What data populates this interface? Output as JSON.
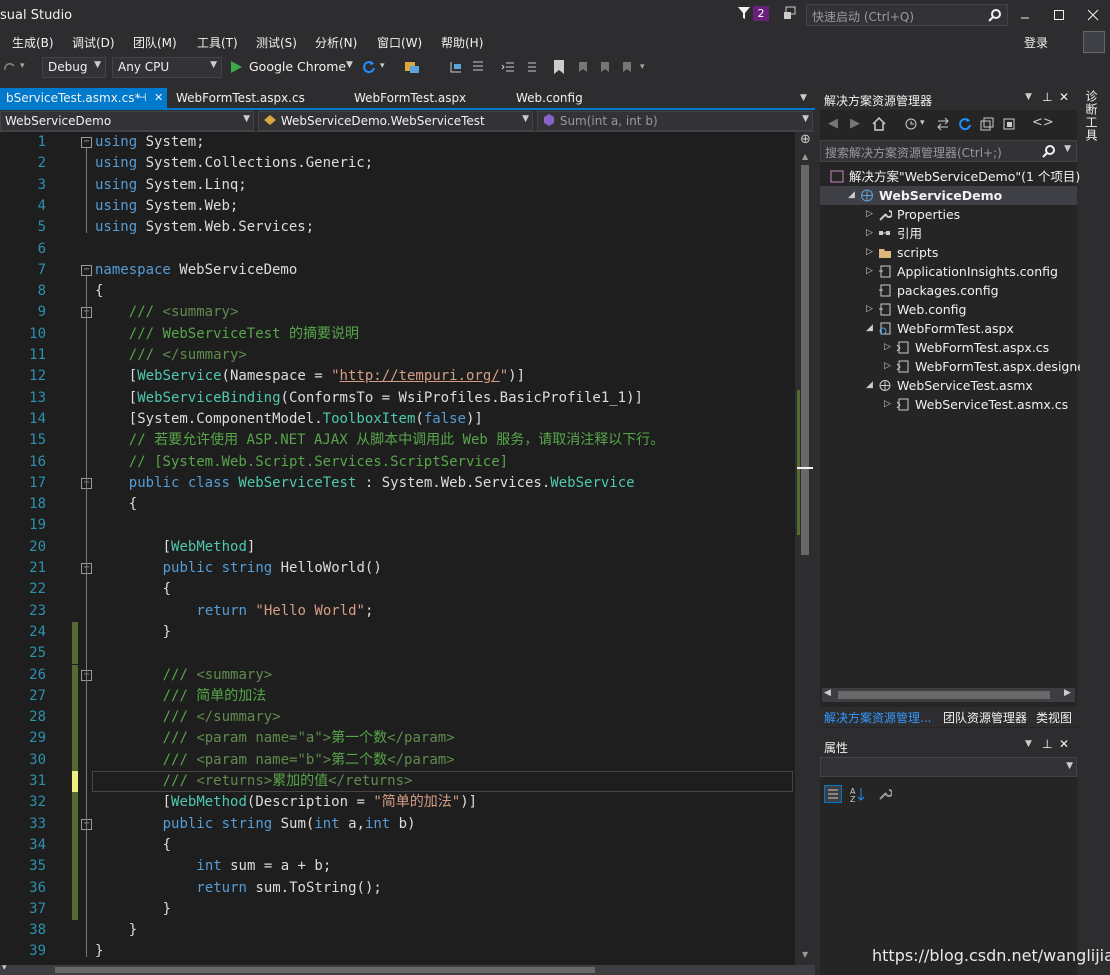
{
  "window": {
    "title": "sual Studio",
    "notification_count": "2",
    "quick_launch_placeholder": "快速启动 (Ctrl+Q)",
    "login": "登录"
  },
  "menu": [
    "生成(B)",
    "调试(D)",
    "团队(M)",
    "工具(T)",
    "测试(S)",
    "分析(N)",
    "窗口(W)",
    "帮助(H)"
  ],
  "toolbar": {
    "config": "Debug",
    "platform": "Any CPU",
    "run_target": "Google Chrome"
  },
  "tabs": [
    {
      "label": "bServiceTest.asmx.cs*",
      "pin": "⊣",
      "close": "✕",
      "active": true
    },
    {
      "label": "WebFormTest.aspx.cs",
      "active": false
    },
    {
      "label": "WebFormTest.aspx",
      "active": false
    },
    {
      "label": "Web.config",
      "active": false
    }
  ],
  "navbar": {
    "project": "WebServiceDemo",
    "type": "WebServiceDemo.WebServiceTest",
    "member": "Sum(int a, int b)"
  },
  "line_numbers": [
    "1",
    "2",
    "3",
    "4",
    "5",
    "6",
    "7",
    "8",
    "9",
    "10",
    "11",
    "12",
    "13",
    "14",
    "15",
    "16",
    "17",
    "18",
    "19",
    "20",
    "21",
    "22",
    "23",
    "24",
    "25",
    "26",
    "27",
    "28",
    "29",
    "30",
    "31",
    "32",
    "33",
    "34",
    "35",
    "36",
    "37",
    "38",
    "39"
  ],
  "code": {
    "l1": [
      "using",
      " System;"
    ],
    "l2": [
      "using",
      " System.Collections.Generic;"
    ],
    "l3": [
      "using",
      " System.Linq;"
    ],
    "l4": [
      "using",
      " System.Web;"
    ],
    "l5": [
      "using",
      " System.Web.Services;"
    ],
    "l7": [
      "namespace",
      " WebServiceDemo"
    ],
    "l8": "{",
    "l9": [
      "/// ",
      "<summary>"
    ],
    "l10": "/// WebServiceTest 的摘要说明",
    "l11": [
      "/// ",
      "</summary>"
    ],
    "l12": [
      "[",
      "WebService",
      "(Namespace = ",
      "\"",
      "http://tempuri.org/",
      "\"",
      ")]"
    ],
    "l13": [
      "[",
      "WebServiceBinding",
      "(ConformsTo = WsiProfiles.BasicProfile1_1)]"
    ],
    "l14": [
      "[System.ComponentModel.",
      "ToolboxItem",
      "(",
      "false",
      ")]"
    ],
    "l15": "// 若要允许使用 ASP.NET AJAX 从脚本中调用此 Web 服务，请取消注释以下行。",
    "l16": "// [System.Web.Script.Services.ScriptService]",
    "l17": [
      "public",
      " ",
      "class",
      " ",
      "WebServiceTest",
      " : System.Web.Services.",
      "WebService"
    ],
    "l18": "{",
    "l20": [
      "[",
      "WebMethod",
      "]"
    ],
    "l21": [
      "public",
      " ",
      "string",
      " HelloWorld()"
    ],
    "l22": "{",
    "l23": [
      "return",
      " ",
      "\"Hello World\"",
      ";"
    ],
    "l24": "}",
    "l26": [
      "/// ",
      "<summary>"
    ],
    "l27": "/// 简单的加法",
    "l28": [
      "/// ",
      "</summary>"
    ],
    "l29": [
      "/// ",
      "<param name=\"a\">",
      "第一个数",
      "</param>"
    ],
    "l30": [
      "/// ",
      "<param name=\"b\">",
      "第二个数",
      "</param>"
    ],
    "l31": [
      "/// ",
      "<returns>",
      "累加的值",
      "</returns>"
    ],
    "l32": [
      "[",
      "WebMethod",
      "(Description = ",
      "\"简单的加法\"",
      ")]"
    ],
    "l33": [
      "public",
      " ",
      "string",
      " Sum(",
      "int",
      " a,",
      "int",
      " b)"
    ],
    "l34": "{",
    "l35": [
      "int",
      " sum = a + b;"
    ],
    "l36": [
      "return",
      " sum.ToString();"
    ],
    "l37": "}",
    "l38": "}",
    "l39": "}"
  },
  "solution_explorer": {
    "title": "解决方案资源管理器",
    "search_placeholder": "搜索解决方案资源管理器(Ctrl+;)",
    "tree": [
      {
        "label": "解决方案\"WebServiceDemo\"(1 个项目)",
        "icon": "solution-icon"
      },
      {
        "label": "WebServiceDemo",
        "icon": "web-project-icon"
      },
      {
        "label": "Properties",
        "icon": "wrench-icon"
      },
      {
        "label": "引用",
        "icon": "references-icon"
      },
      {
        "label": "scripts",
        "icon": "folder-icon"
      },
      {
        "label": "ApplicationInsights.config",
        "icon": "config-icon"
      },
      {
        "label": "packages.config",
        "icon": "config-icon"
      },
      {
        "label": "Web.config",
        "icon": "config-icon"
      },
      {
        "label": "WebFormTest.aspx",
        "icon": "aspx-icon"
      },
      {
        "label": "WebFormTest.aspx.cs",
        "icon": "csharp-file-icon"
      },
      {
        "label": "WebFormTest.aspx.designer.c",
        "icon": "csharp-file-icon"
      },
      {
        "label": "WebServiceTest.asmx",
        "icon": "asmx-icon"
      },
      {
        "label": "WebServiceTest.asmx.cs",
        "icon": "csharp-file-icon"
      }
    ],
    "bottom_tabs": [
      "解决方案资源管理...",
      "团队资源管理器",
      "类视图"
    ]
  },
  "properties": {
    "title": "属性"
  },
  "side_tab": "诊断工具",
  "watermark": "https://blog.csdn.net/wanglijia26",
  "colors": {
    "accent": "#007acc",
    "keyword": "#569cd6",
    "type": "#4ec9b0",
    "comment": "#57a64a",
    "string": "#d69d85",
    "linenumber": "#2b91af"
  }
}
